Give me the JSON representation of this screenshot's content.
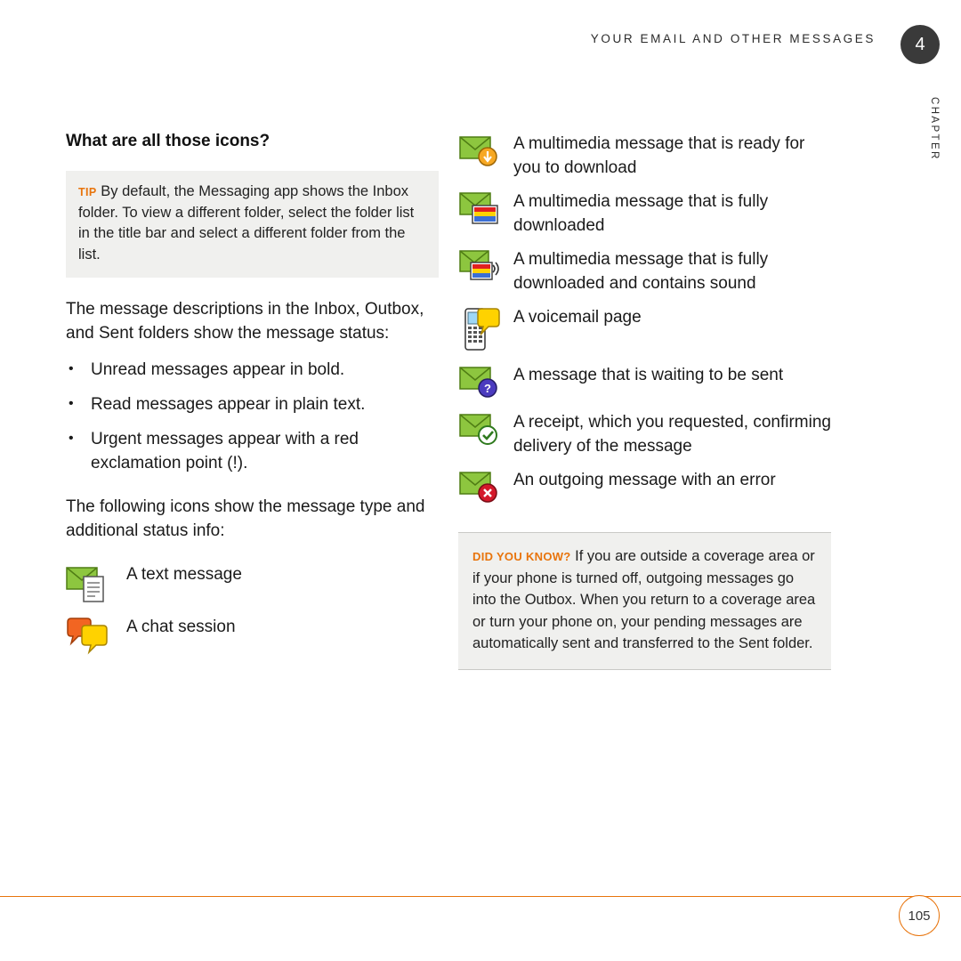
{
  "header": {
    "title": "YOUR EMAIL AND OTHER MESSAGES",
    "chapter_number": "4",
    "chapter_label": "CHAPTER"
  },
  "left": {
    "section_title": "What are all those icons?",
    "tip": {
      "label": "TIP",
      "text": " By default, the Messaging app shows the Inbox folder. To view a different folder, select the folder list in the title bar and select a different folder from the list."
    },
    "para1": "The message descriptions in the Inbox, Outbox, and Sent folders show the message status:",
    "bullets": [
      "Unread messages appear in bold.",
      "Read messages appear in plain text.",
      "Urgent messages appear with a red exclamation point (!)."
    ],
    "para2": "The following icons show the message type and additional status info:",
    "icons": [
      {
        "icon": "text-message-icon",
        "label": "A text message"
      },
      {
        "icon": "chat-session-icon",
        "label": "A chat session"
      }
    ]
  },
  "right": {
    "icons": [
      {
        "icon": "mms-ready-to-download-icon",
        "label": "A multimedia message that is ready for you to download"
      },
      {
        "icon": "mms-downloaded-icon",
        "label": "A multimedia message that is fully downloaded"
      },
      {
        "icon": "mms-downloaded-sound-icon",
        "label": "A multimedia message that is fully downloaded and contains sound"
      },
      {
        "icon": "voicemail-page-icon",
        "label": "A voicemail page"
      },
      {
        "icon": "message-waiting-to-send-icon",
        "label": "A message that is waiting to be sent"
      },
      {
        "icon": "delivery-receipt-icon",
        "label": "A receipt, which you requested, confirming delivery of the message"
      },
      {
        "icon": "outgoing-message-error-icon",
        "label": "An outgoing message with an error"
      }
    ],
    "did_you_know": {
      "label": "DID YOU KNOW?",
      "text": " If you are outside a coverage area or if your phone is turned off, outgoing messages go into the Outbox. When you return to a coverage area or turn your phone on, your pending messages are automatically sent and transferred to the Sent folder."
    }
  },
  "footer": {
    "page_number": "105"
  },
  "colors": {
    "accent": "#e8740c",
    "box_bg": "#f0f0ee",
    "badge_bg": "#3a3a3a",
    "envelope_green": "#8dc63f",
    "envelope_dark_green": "#5a9216"
  }
}
